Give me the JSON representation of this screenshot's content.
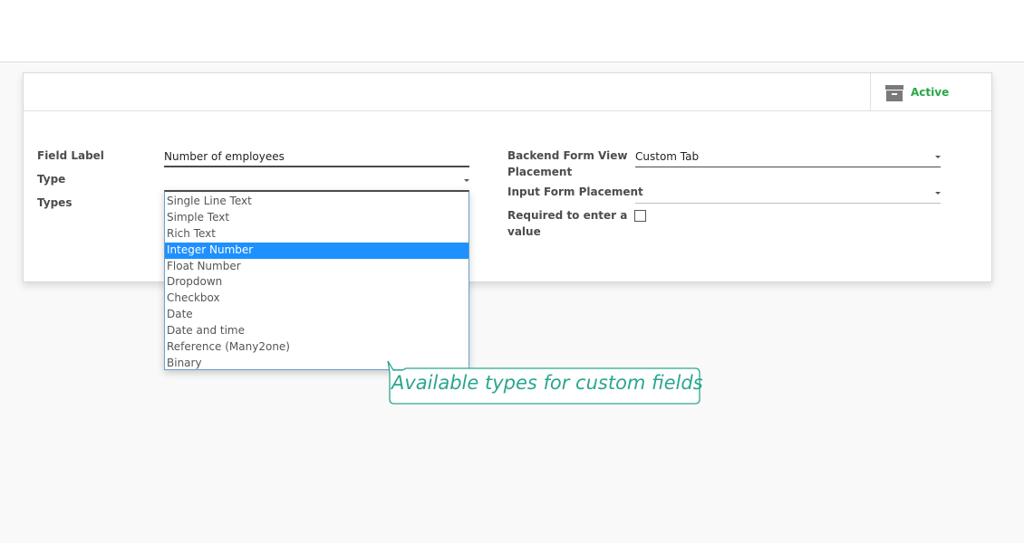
{
  "header": {},
  "status_button": {
    "label": "Active",
    "icon": "archive-icon",
    "color": "#28a745"
  },
  "form": {
    "left": {
      "field_label": {
        "label": "Field Label",
        "value": "Number of employees"
      },
      "type": {
        "label": "Type",
        "value": ""
      },
      "types": {
        "label": "Types"
      }
    },
    "right": {
      "backend_placement": {
        "label_line1": "Backend Form View",
        "label_line2": "Placement",
        "value": "Custom Tab"
      },
      "input_placement": {
        "label": "Input Form Placement",
        "value": ""
      },
      "required": {
        "label_line1": "Required to enter a",
        "label_line2": "value",
        "checked": false
      }
    }
  },
  "dropdown": {
    "options": [
      "Single Line Text",
      "Simple Text",
      "Rich Text",
      "Integer Number",
      "Float Number",
      "Dropdown",
      "Checkbox",
      "Date",
      "Date and time",
      "Reference (Many2one)",
      "Binary"
    ],
    "selected": "Integer Number",
    "highlight_color": "#1e90ff"
  },
  "tooltip": {
    "text": "Available types for custom fields",
    "color": "#2aa68f"
  }
}
